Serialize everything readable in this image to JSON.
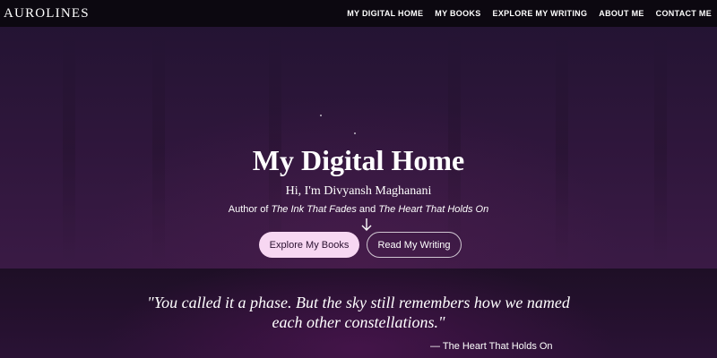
{
  "navbar": {
    "brand": "AUROLINES",
    "links": [
      "MY DIGITAL HOME",
      "MY BOOKS",
      "EXPLORE MY WRITING",
      "ABOUT ME",
      "CONTACT ME"
    ]
  },
  "hero": {
    "title": "My Digital Home",
    "greeting": "Hi, I'm Divyansh Maghanani",
    "author_prefix": "Author of ",
    "book1": "The Ink That Fades",
    "author_and": " and ",
    "book2": "The Heart That Holds On",
    "arrow_icon": "arrow-down-icon",
    "primary_button": "Explore My Books",
    "secondary_button": "Read My Writing"
  },
  "quote": {
    "text": "\"You called it a phase. But the sky still remembers how we named each other constellations.\"",
    "source": "— The Heart That Holds On"
  },
  "colors": {
    "accent_button": "#f7d7f2",
    "hero_bg": "#2e163b",
    "navbar_bg": "#0c0810"
  }
}
